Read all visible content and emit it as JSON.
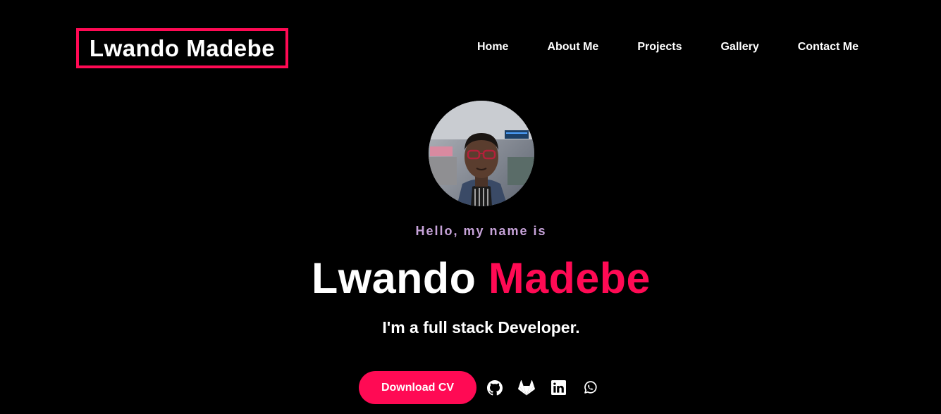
{
  "header": {
    "logo_text": "Lwando Madebe",
    "nav": [
      {
        "label": "Home"
      },
      {
        "label": "About Me"
      },
      {
        "label": "Projects"
      },
      {
        "label": "Gallery"
      },
      {
        "label": "Contact Me"
      }
    ]
  },
  "hero": {
    "greeting": "Hello, my name is",
    "first_name": "Lwando",
    "last_name": "Madebe",
    "role": "I'm a full stack Developer.",
    "cv_button_label": "Download CV",
    "social_icons": [
      "github-icon",
      "gitlab-icon",
      "linkedin-icon",
      "whatsapp-icon"
    ]
  },
  "colors": {
    "background": "#000000",
    "accent": "#ff0a54",
    "greeting": "#c7a3d9",
    "text": "#ffffff"
  }
}
